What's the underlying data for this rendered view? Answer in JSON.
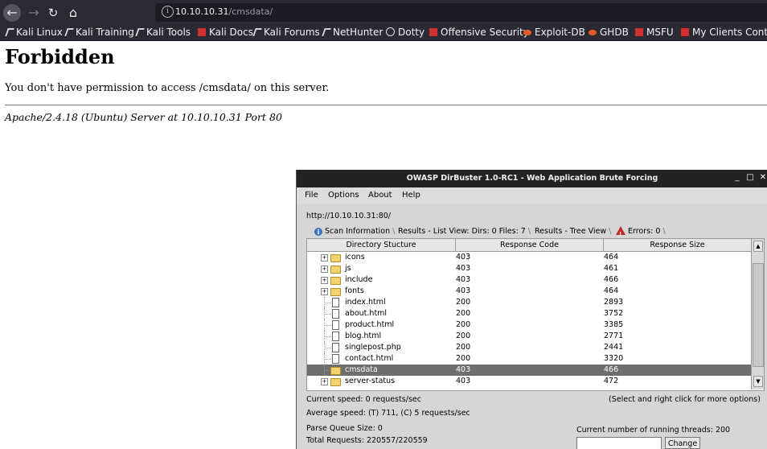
{
  "browser": {
    "url_host": "10.10.10.31",
    "url_path": "/cmsdata/",
    "bookmarks": [
      "Kali Linux",
      "Kali Training",
      "Kali Tools",
      "Kali Docs",
      "Kali Forums",
      "NetHunter",
      "Dotty",
      "Offensive Security",
      "Exploit-DB",
      "GHDB",
      "MSFU",
      "My Clients Control"
    ]
  },
  "page": {
    "title": "Forbidden",
    "message": "You don't have permission to access /cmsdata/ on this server.",
    "address": "Apache/2.4.18 (Ubuntu) Server at 10.10.10.31 Port 80"
  },
  "dirbuster": {
    "window_title": "OWASP DirBuster 1.0-RC1 - Web Application Brute Forcing",
    "menu": [
      "File",
      "Options",
      "About",
      "Help"
    ],
    "target_url": "http://10.10.10.31:80/",
    "tabs": {
      "scan_info": "Scan Information",
      "list_view": "Results - List View: Dirs: 0 Files: 7",
      "tree_view": "Results - Tree View",
      "errors": "Errors: 0"
    },
    "columns": [
      "Directory Stucture",
      "Response Code",
      "Response Size"
    ],
    "rows": [
      {
        "name": "icons",
        "code": "403",
        "size": "464",
        "type": "folder"
      },
      {
        "name": "js",
        "code": "403",
        "size": "461",
        "type": "folder"
      },
      {
        "name": "include",
        "code": "403",
        "size": "466",
        "type": "folder"
      },
      {
        "name": "fonts",
        "code": "403",
        "size": "464",
        "type": "folder"
      },
      {
        "name": "index.html",
        "code": "200",
        "size": "2893",
        "type": "file"
      },
      {
        "name": "about.html",
        "code": "200",
        "size": "3752",
        "type": "file"
      },
      {
        "name": "product.html",
        "code": "200",
        "size": "3385",
        "type": "file"
      },
      {
        "name": "blog.html",
        "code": "200",
        "size": "2771",
        "type": "file"
      },
      {
        "name": "singlepost.php",
        "code": "200",
        "size": "2441",
        "type": "file"
      },
      {
        "name": "contact.html",
        "code": "200",
        "size": "3320",
        "type": "file"
      },
      {
        "name": "cmsdata",
        "code": "403",
        "size": "466",
        "type": "folder-open",
        "selected": true
      },
      {
        "name": "server-status",
        "code": "403",
        "size": "472",
        "type": "folder"
      }
    ],
    "current_speed": "Current speed: 0 requests/sec",
    "hint": "(Select and right click for more options)",
    "average_speed": "Average speed: (T) 711, (C) 5 requests/sec",
    "parse_queue": "Parse Queue Size: 0",
    "threads": "Current number of running threads: 200",
    "total_requests": "Total Requests: 220557/220559",
    "change_button": "Change"
  },
  "colors": {
    "chrome_bg": "#2b2a33",
    "selection": "#6e6e6e",
    "window_bg": "#d6d6d6"
  }
}
